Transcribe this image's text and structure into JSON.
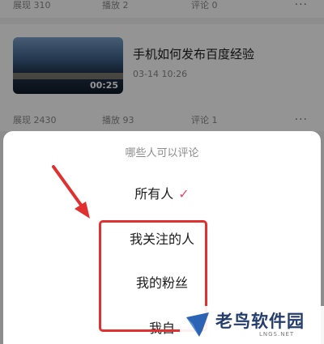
{
  "top_stats": {
    "views": "展现 310",
    "plays": "播放 2",
    "comments": "评论 0"
  },
  "video": {
    "title": "手机如何发布百度经验",
    "date": "03-14 10:26",
    "duration": "00:25",
    "stats": {
      "views": "展现 2430",
      "plays": "播放 93",
      "comments": "评论 1"
    }
  },
  "more_label": "···",
  "comment_sheet": {
    "title": "哪些人可以评论",
    "options": [
      {
        "label": "所有人",
        "selected": true
      },
      {
        "label": "我关注的人",
        "selected": false
      },
      {
        "label": "我的粉丝",
        "selected": false
      },
      {
        "label": "我自",
        "selected": false
      }
    ],
    "check_mark": "✓"
  },
  "watermark": {
    "brand": "老鸟软件园",
    "sub": "LNGS.NET"
  },
  "colors": {
    "accent_check": "#e9486f",
    "annotation_red": "#e03030",
    "brand_blue": "#233d6c"
  }
}
